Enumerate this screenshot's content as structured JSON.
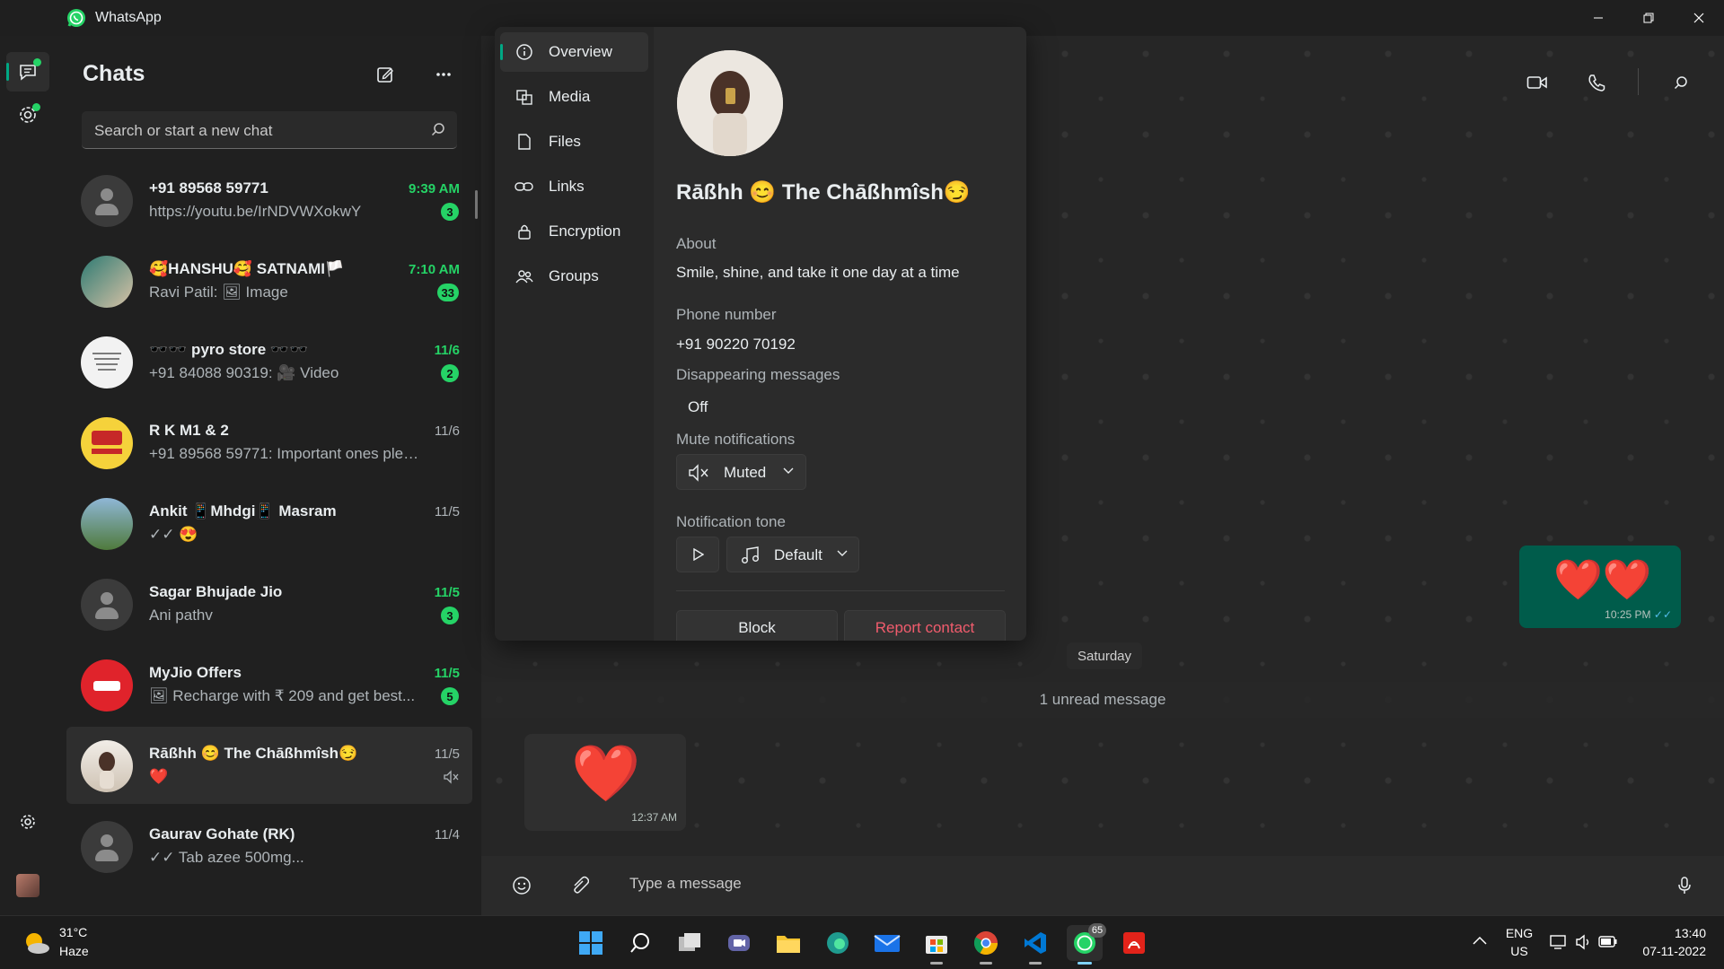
{
  "titlebar": {
    "app_name": "WhatsApp"
  },
  "sidebar": {
    "title": "Chats",
    "search_placeholder": "Search or start a new chat"
  },
  "chats": [
    {
      "name": "+91 89568 59771",
      "preview": "https://youtu.be/IrNDVWXokwY",
      "time": "9:39 AM",
      "unread": "3",
      "avatar": "default"
    },
    {
      "name": "🥰HANSHU🥰 SATNAMI🏳️",
      "preview": "Ravi Patil: 🖼 Image",
      "time": "7:10 AM",
      "unread": "33",
      "avatar": "photo"
    },
    {
      "name": "🕶️🕶️ pyro store 🕶️🕶️",
      "preview": "+91 84088 90319: 🎥 Video",
      "time": "11/6",
      "unread": "2",
      "avatar": "poster"
    },
    {
      "name": "R K M1 & 2",
      "preview": "+91 89568 59771: Important ones plea...",
      "time": "11/6",
      "unread": "",
      "avatar": "rk"
    },
    {
      "name": "Ankit 📱Mhdgi📱 Masram",
      "preview": "✓✓ 😍",
      "time": "11/5",
      "unread": "",
      "avatar": "group"
    },
    {
      "name": "Sagar Bhujade Jio",
      "preview": "Ani pathv",
      "time": "11/5",
      "unread": "3",
      "avatar": "default"
    },
    {
      "name": "MyJio Offers",
      "preview": "🖼 Recharge with ₹ 209 and get best...",
      "time": "11/5",
      "unread": "5",
      "avatar": "jio"
    },
    {
      "name": "Rāßhh 😊 The Chāßhmîsh😏",
      "preview": "❤️",
      "time": "11/5",
      "unread": "",
      "avatar": "girl",
      "selected": true,
      "muted": true
    },
    {
      "name": "Gaurav Gohate (RK)",
      "preview": "✓✓ Tab azee 500mg...",
      "time": "11/4",
      "unread": "",
      "avatar": "default"
    }
  ],
  "profile": {
    "nav": [
      "Overview",
      "Media",
      "Files",
      "Links",
      "Encryption",
      "Groups"
    ],
    "name": "Rāßhh 😊 The Chāßhmîsh😏",
    "about_label": "About",
    "about": "Smile, shine, and take it one day  at a time",
    "phone_label": "Phone number",
    "phone": "+91 90220 70192",
    "disappearing_label": "Disappearing messages",
    "disappearing_value": "Off",
    "mute_label": "Mute notifications",
    "mute_value": "Muted",
    "tone_label": "Notification tone",
    "tone_value": "Default",
    "block_label": "Block",
    "report_label": "Report contact"
  },
  "conversation": {
    "out_message": {
      "content": "❤️❤️",
      "time": "10:25 PM"
    },
    "date_separator": "Saturday",
    "unread_banner": "1 unread message",
    "in_message": {
      "content": "❤️",
      "time": "12:37 AM"
    },
    "composer_placeholder": "Type a message"
  },
  "taskbar": {
    "weather_temp": "31°C",
    "weather_desc": "Haze",
    "lang_primary": "ENG",
    "lang_secondary": "US",
    "time": "13:40",
    "date": "07-11-2022",
    "whatsapp_badge": "65"
  },
  "colors": {
    "accent": "#00a884",
    "unread": "#25d366",
    "outgoing_bubble": "#005c4b",
    "incoming_bubble": "#2f2f2f",
    "report": "#f15c6d"
  }
}
